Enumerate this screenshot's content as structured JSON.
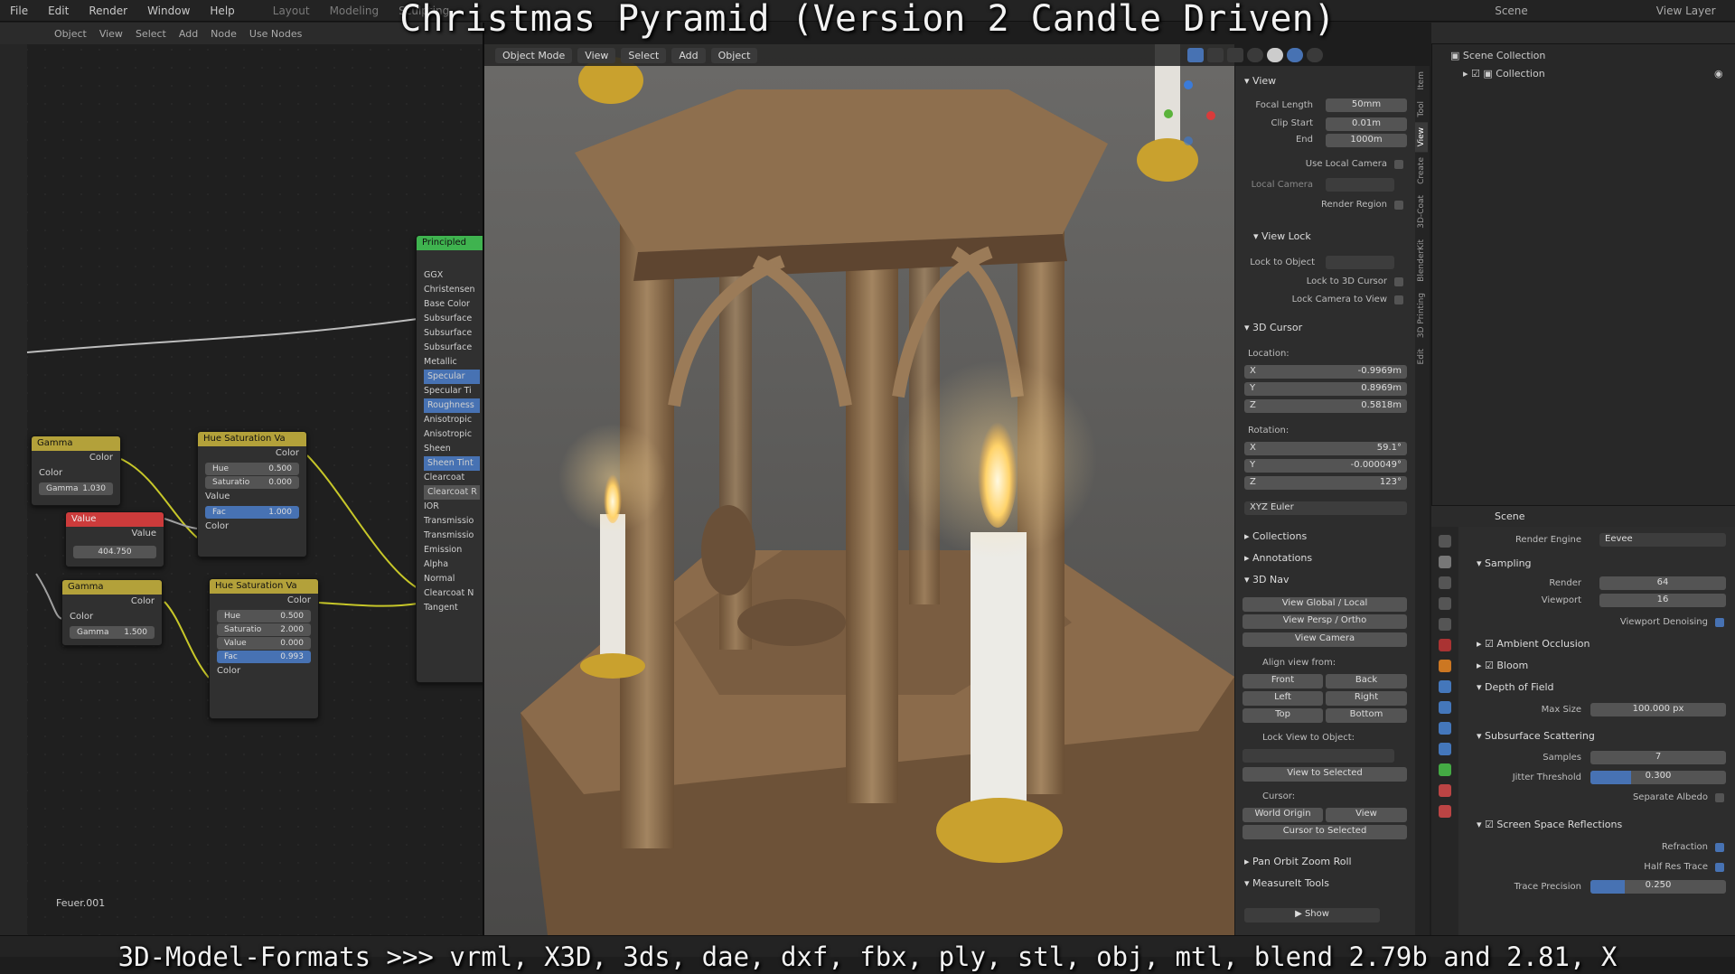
{
  "video": {
    "title": "Christmas Pyramid (Version 2 Candle Driven)",
    "footer": "3D-Model-Formats >>> vrml, X3D, 3ds, dae, dxf, fbx, ply, stl, obj, mtl, blend 2.79b and 2.81, X"
  },
  "topbar": {
    "menus": [
      "File",
      "Edit",
      "Render",
      "Window",
      "Help"
    ],
    "workspaces": [
      "Layout",
      "Modeling",
      "Sculpting"
    ],
    "scene_label": "Scene",
    "view_layer_label": "View Layer"
  },
  "node_editor": {
    "header": [
      "Object",
      "View",
      "Select",
      "Add",
      "Node",
      "Use Nodes"
    ],
    "frame_label": "Feuer.001",
    "principled": {
      "title": "Principled",
      "inputs": [
        "GGX",
        "Christensen",
        "Base Color",
        "Subsurface",
        "Subsurface",
        "Subsurface",
        "Metallic",
        "Specular",
        "Specular Ti",
        "Roughness",
        "Anisotropic",
        "Anisotropic",
        "Sheen",
        "Sheen Tint",
        "Clearcoat",
        "Clearcoat R",
        "IOR",
        "Transmissio",
        "Transmissio",
        "Emission",
        "Alpha",
        "Normal",
        "Clearcoat N",
        "Tangent"
      ]
    },
    "gamma1": {
      "title": "Gamma",
      "out": "Color",
      "in_color": "Color",
      "gamma_label": "Gamma",
      "gamma_value": "1.030"
    },
    "value": {
      "title": "Value",
      "out": "Value",
      "value": "404.750"
    },
    "gamma2": {
      "title": "Gamma",
      "out": "Color",
      "in_color": "Color",
      "gamma_label": "Gamma",
      "gamma_value": "1.500"
    },
    "hsv1": {
      "title": "Hue Saturation Va",
      "out": "Color",
      "hue_label": "Hue",
      "hue": "0.500",
      "sat_label": "Saturatio",
      "sat": "0.000",
      "value_label": "Value",
      "fac_label": "Fac",
      "fac": "1.000",
      "color_label": "Color"
    },
    "hsv2": {
      "title": "Hue Saturation Va",
      "out": "Color",
      "hue_label": "Hue",
      "hue": "0.500",
      "sat_label": "Saturatio",
      "sat": "2.000",
      "value_label": "Value",
      "value": "0.000",
      "fac_label": "Fac",
      "fac": "0.993",
      "color_label": "Color"
    }
  },
  "viewport": {
    "mode": "Object Mode",
    "menus": [
      "View",
      "Select",
      "Add",
      "Object"
    ]
  },
  "npanel": {
    "view": {
      "title": "View",
      "focal_length_label": "Focal Length",
      "focal_length": "50mm",
      "clip_start_label": "Clip Start",
      "clip_start": "0.01m",
      "end_label": "End",
      "end": "1000m",
      "use_local_camera": "Use Local Camera",
      "local_camera": "Local Camera",
      "render_region": "Render Region"
    },
    "view_lock": {
      "title": "View Lock",
      "lock_to_object": "Lock to Object",
      "lock_to_cursor": "Lock to 3D Cursor",
      "lock_camera": "Lock Camera to View"
    },
    "cursor": {
      "title": "3D Cursor",
      "location_label": "Location:",
      "x_label": "X",
      "x": "-0.9969m",
      "y_label": "Y",
      "y": "0.8969m",
      "z_label": "Z",
      "z": "0.5818m",
      "rotation_label": "Rotation:",
      "rx": "59.1°",
      "ry": "-0.000049°",
      "rz": "123°",
      "mode": "XYZ Euler"
    },
    "collections": "Collections",
    "annotations": "Annotations",
    "nav": {
      "title": "3D Nav",
      "view_global": "View Global / Local",
      "view_persp": "View Persp / Ortho",
      "view_camera": "View Camera",
      "align_label": "Align view from:",
      "front": "Front",
      "back": "Back",
      "left": "Left",
      "right": "Right",
      "top": "Top",
      "bottom": "Bottom",
      "lock_view_label": "Lock View to Object:",
      "view_selected": "View to Selected",
      "cursor_label": "Cursor:",
      "world_origin": "World Origin",
      "cursor_view": "View",
      "cursor_to_selected": "Cursor to Selected"
    },
    "pan_orbit": "Pan Orbit Zoom Roll",
    "measureit": "MeasureIt Tools",
    "show": "Show",
    "tabs": [
      "Item",
      "Tool",
      "View",
      "Create",
      "3D-Coat",
      "BlenderKit",
      "3D Printing",
      "Edit"
    ]
  },
  "outliner": {
    "scene_collection": "Scene Collection",
    "collection": "Collection"
  },
  "properties": {
    "header": "Scene",
    "render_engine_label": "Render Engine",
    "render_engine": "Eevee",
    "sampling": "Sampling",
    "render_label": "Render",
    "render": "64",
    "viewport_label": "Viewport",
    "viewport": "16",
    "denoising": "Viewport Denoising",
    "ao": "Ambient Occlusion",
    "bloom": "Bloom",
    "dof": "Depth of Field",
    "max_size_label": "Max Size",
    "max_size": "100.000 px",
    "sss": "Subsurface Scattering",
    "samples_label": "Samples",
    "samples": "7",
    "jitter_label": "Jitter Threshold",
    "jitter": "0.300",
    "jitter_fill": 0.3,
    "albedo": "Separate Albedo",
    "ssr": "Screen Space Reflections",
    "refraction": "Refraction",
    "half_res": "Half Res Trace",
    "trace_label": "Trace Precision",
    "trace": "0.250",
    "trace_fill": 0.25
  },
  "colors": {
    "accent": "#4772b3",
    "node_vector": "#6363c7",
    "node_color": "#c7c729",
    "value_node": "#cc3b3b",
    "gamma_header": "#b3a13a",
    "principled_header": "#3fb34f"
  }
}
